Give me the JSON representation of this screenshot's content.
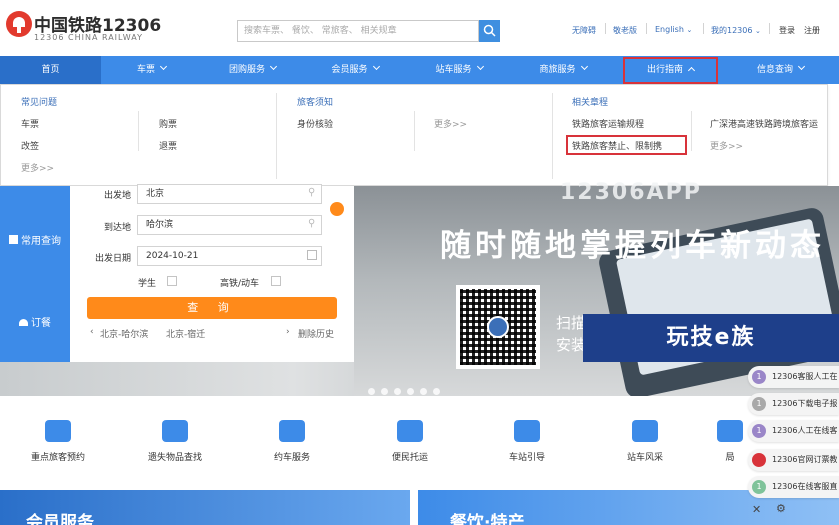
{
  "header": {
    "logo_cn": "中国铁路12306",
    "logo_en": "12306 CHINA RAILWAY",
    "search_placeholder": "搜索车票、 餐饮、 常旅客、 相关规章",
    "links": [
      "无障碍",
      "敬老版",
      "English",
      "我的12306",
      "登录",
      "注册"
    ]
  },
  "nav": {
    "items": [
      "首页",
      "车票",
      "团购服务",
      "会员服务",
      "站车服务",
      "商旅服务",
      "出行指南",
      "信息查询"
    ]
  },
  "dropdown": {
    "sections": [
      {
        "title": "常见问题",
        "items": [
          "车票",
          "改签",
          "更多>>",
          "购票",
          "退票"
        ]
      },
      {
        "title": "旅客须知",
        "items": [
          "身份核验",
          "更多>>"
        ]
      },
      {
        "title": "相关章程",
        "items": [
          "铁路旅客运输规程",
          "铁路旅客禁止、限制携",
          "广深港高速铁路跨境旅客运",
          "更多>>"
        ]
      }
    ]
  },
  "ticket_form": {
    "side_items": [
      "常用查询",
      "订餐"
    ],
    "from_label": "出发地",
    "from_value": "北京",
    "to_label": "到达地",
    "to_value": "哈尔滨",
    "date_label": "出发日期",
    "date_value": "2024-10-21",
    "student_label": "学生",
    "highspeed_label": "高铁/动车",
    "query_label": "查 询",
    "history": [
      "北京-哈尔滨",
      "北京-宿迁"
    ],
    "clear_history": "删除历史"
  },
  "banner": {
    "app_title": "12306APP",
    "slogan": "随时随地掌握列车新动态",
    "scan_line1": "扫描",
    "scan_line2": "安装"
  },
  "watermark": "玩技e族",
  "services": [
    "重点旅客预约",
    "遗失物品查找",
    "约车服务",
    "便民托运",
    "车站引导",
    "站车风采",
    "局"
  ],
  "cards": {
    "left_title": "会员服务",
    "right_title": "餐饮·特产"
  },
  "notifications": [
    {
      "num": "1",
      "text": "12306客服人工在"
    },
    {
      "num": "1",
      "text": "12306下载电子报"
    },
    {
      "num": "1",
      "text": "12306人工在线客"
    },
    {
      "num": "",
      "text": "12306官网订票教"
    },
    {
      "num": "1",
      "text": "12306在线客服直"
    }
  ],
  "colors": {
    "nav_blue": "#3d8be8",
    "nav_home": "#2a6fc9",
    "accent_orange": "#ff8a1a",
    "highlight_red": "#d8333a",
    "link_blue": "#3b6fb8"
  }
}
